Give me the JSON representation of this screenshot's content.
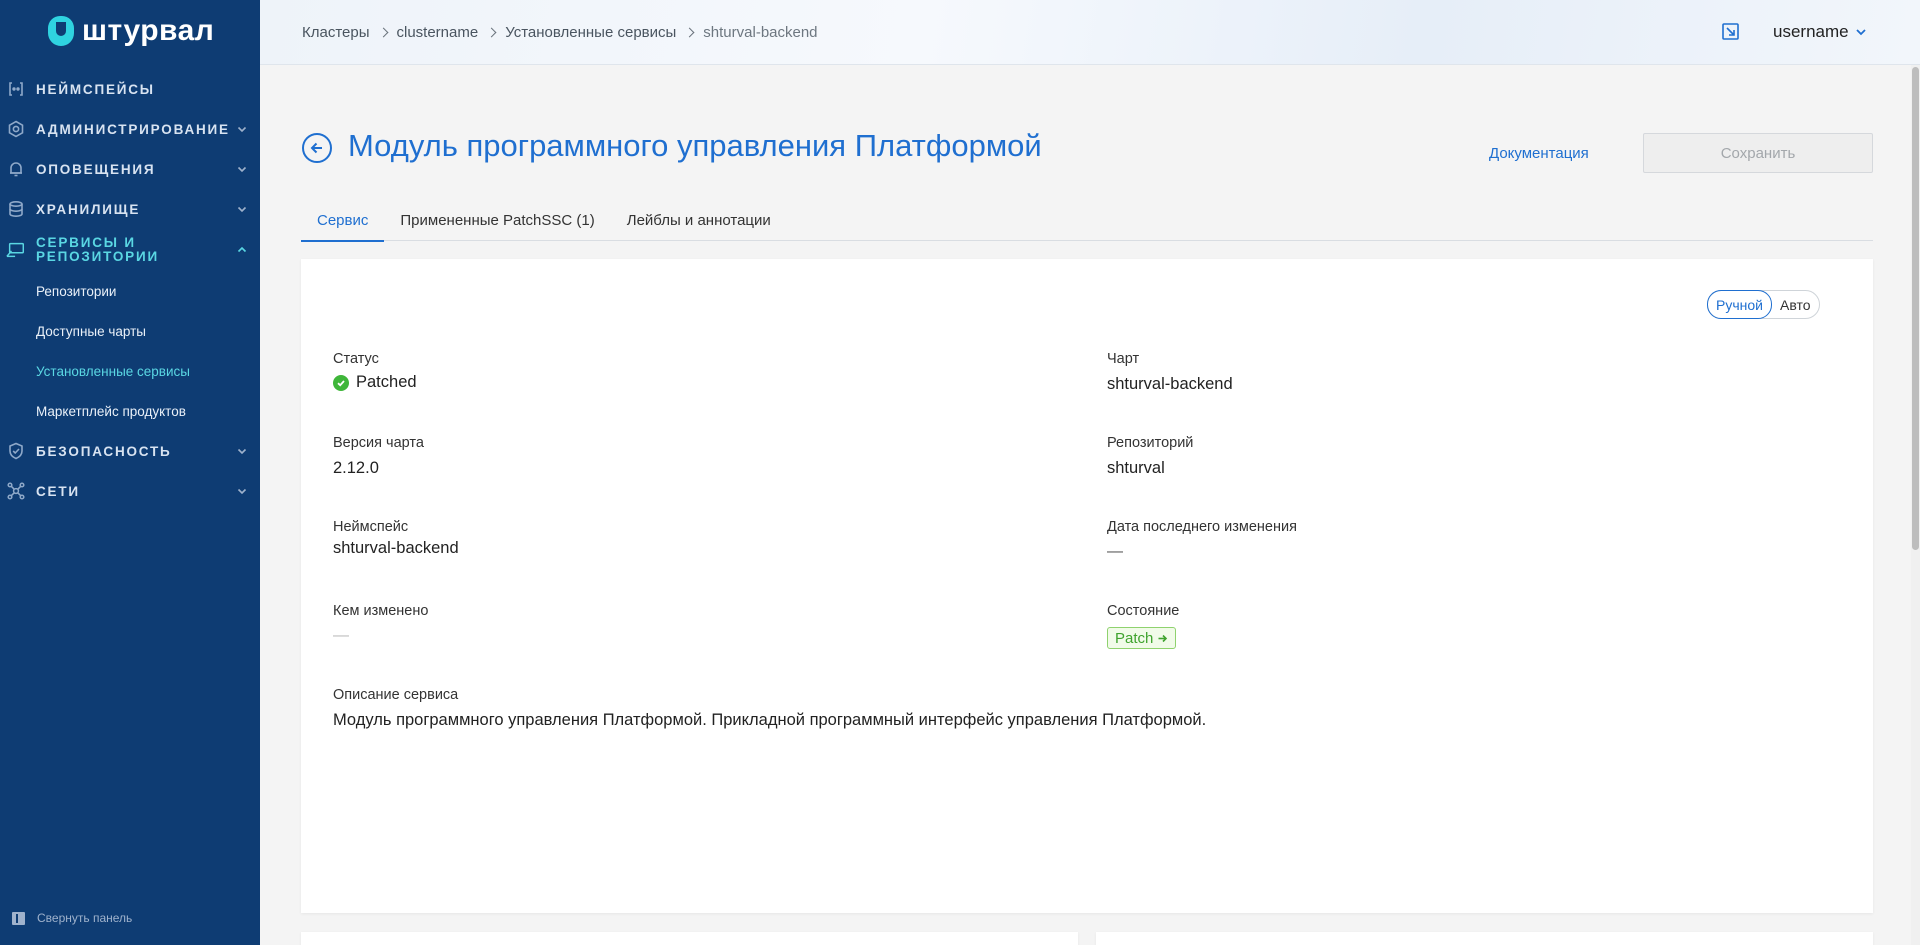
{
  "app": {
    "logo_text": "штурвал"
  },
  "sidebar": {
    "items": [
      {
        "label": "Неймспейсы",
        "icon": "namespace-icon",
        "has_chevron": false
      },
      {
        "label": "Администрирование",
        "icon": "settings-gear-icon",
        "has_chevron": true
      },
      {
        "label": "Оповещения",
        "icon": "bell-icon",
        "has_chevron": true
      },
      {
        "label": "Хранилище",
        "icon": "database-icon",
        "has_chevron": true
      },
      {
        "label": "Сервисы и репозитории",
        "icon": "services-icon",
        "has_chevron": true,
        "expanded": true
      },
      {
        "label": "Безопасность",
        "icon": "shield-icon",
        "has_chevron": true
      },
      {
        "label": "Сети",
        "icon": "network-icon",
        "has_chevron": true
      }
    ],
    "subitems": [
      {
        "label": "Репозитории"
      },
      {
        "label": "Доступные чарты"
      },
      {
        "label": "Установленные сервисы",
        "current": true
      },
      {
        "label": "Маркетплейс продуктов"
      }
    ],
    "collapse_label": "Свернуть панель"
  },
  "header": {
    "breadcrumb": [
      "Кластеры",
      "clustername",
      "Установленные сервисы",
      "shturval-backend"
    ],
    "username": "username"
  },
  "page": {
    "title": "Модуль программного управления Платформой",
    "docs_link": "Документация",
    "save_label": "Сохранить"
  },
  "tabs": [
    {
      "label": "Сервис",
      "active": true
    },
    {
      "label": "Примененные PatchSSC (1)",
      "active": false
    },
    {
      "label": "Лейблы и аннотации",
      "active": false
    }
  ],
  "mode_toggle": {
    "manual": "Ручной",
    "auto": "Авто",
    "selected": "Ручной"
  },
  "details": {
    "status_label": "Статус",
    "status_value": "Patched",
    "chart_label": "Чарт",
    "chart_value": "shturval-backend",
    "chart_version_label": "Версия чарта",
    "chart_version_value": "2.12.0",
    "repo_label": "Репозиторий",
    "repo_value": "shturval",
    "namespace_label": "Неймспейс",
    "namespace_value": "shturval-backend",
    "last_change_label": "Дата последнего изменения",
    "last_change_value": "—",
    "changed_by_label": "Кем изменено",
    "changed_by_value": "—",
    "state_label": "Состояние",
    "state_value": "Patch",
    "description_label": "Описание сервиса",
    "description_value": "Модуль программного управления Платформой. Прикладной программный интерфейс управления Платформой."
  },
  "colors": {
    "sidebar_bg": "#0e3c73",
    "accent": "#1f6fd0",
    "sidebar_active": "#5ad7e3",
    "success": "#3fb63a"
  }
}
